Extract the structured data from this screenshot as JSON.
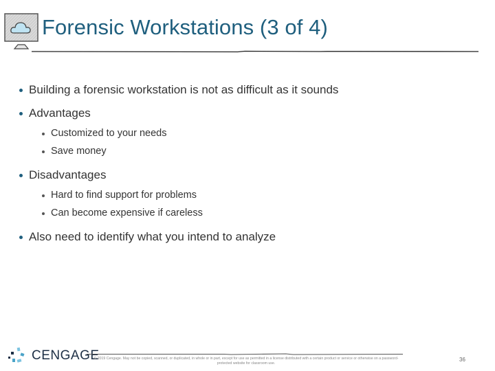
{
  "header": {
    "icon": "monitor-cloud-icon",
    "title": "Forensic Workstations (3 of 4)"
  },
  "bullets": [
    {
      "text": "Building a forensic workstation is not as difficult as it sounds",
      "children": []
    },
    {
      "text": "Advantages",
      "children": [
        "Customized to your needs",
        "Save money"
      ]
    },
    {
      "text": "Disadvantages",
      "children": [
        "Hard to find support for problems",
        "Can become expensive if careless"
      ]
    },
    {
      "text": "Also need to identify what you intend to analyze",
      "children": []
    }
  ],
  "footer": {
    "logo_icon": "cengage-logo-icon",
    "logo_text": "CENGAGE",
    "copyright": "© 2019 Cengage. May not be copied, scanned, or duplicated, in whole or in part, except for use as permitted in a license distributed with a certain product or service or otherwise on a password-protected website for classroom use.",
    "page_number": "36"
  },
  "colors": {
    "title": "#1f5f7e",
    "body_text": "#333333",
    "logo_text": "#1d2f45",
    "logo_accent": "#4aa3c8"
  }
}
